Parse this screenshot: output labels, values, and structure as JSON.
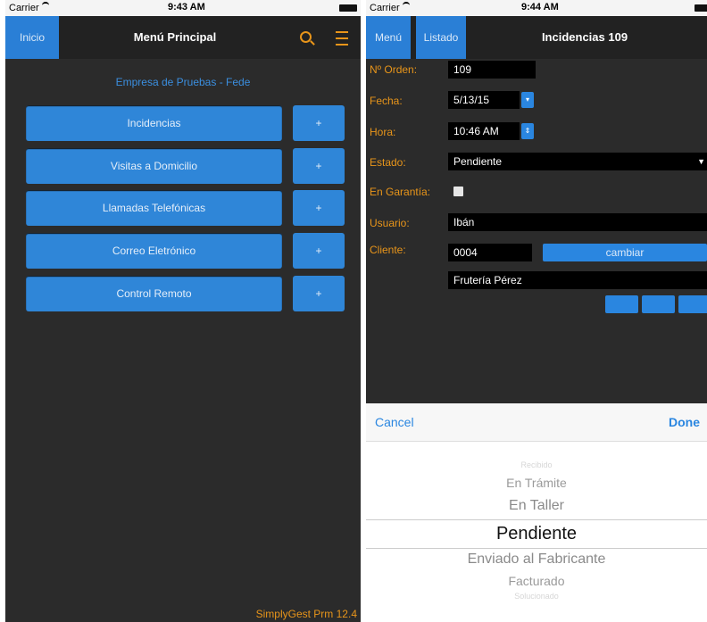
{
  "left_screen": {
    "status": {
      "carrier": "Carrier",
      "time": "9:43 AM"
    },
    "nav": {
      "home_label": "Inicio",
      "title": "Menú Principal",
      "search_icon": "search-icon",
      "menu_icon": "hamburger-icon"
    },
    "company": "Empresa de Pruebas - Fede",
    "menu_items": [
      {
        "label": "Incidencias",
        "plus": "+"
      },
      {
        "label": "Visitas a Domicilio",
        "plus": "+"
      },
      {
        "label": "Llamadas Telefónicas",
        "plus": "+"
      },
      {
        "label": "Correo Eletrónico",
        "plus": "+"
      },
      {
        "label": "Control Remoto",
        "plus": "+"
      }
    ],
    "footer": "SimplyGest Prm 12.4"
  },
  "right_screen": {
    "status": {
      "carrier": "Carrier",
      "time": "9:44 AM"
    },
    "nav": {
      "menu_label": "Menú",
      "list_label": "Listado",
      "title": "Incidencias 109"
    },
    "form": {
      "order_label": "Nº Orden:",
      "order_value": "109",
      "date_label": "Fecha:",
      "date_value": "5/13/15",
      "time_label": "Hora:",
      "time_value": "10:46 AM",
      "state_label": "Estado:",
      "state_value": "Pendiente",
      "warranty_label": "En Garantía:",
      "warranty_checked": false,
      "user_label": "Usuario:",
      "user_value": "Ibán",
      "client_label": "Cliente:",
      "client_code": "0004",
      "change_label": "cambiar",
      "client_name": "Frutería Pérez"
    },
    "picker": {
      "cancel_label": "Cancel",
      "done_label": "Done",
      "options": [
        "Recibido",
        "En Trámite",
        "En Taller",
        "Pendiente",
        "Enviado al Fabricante",
        "Facturado",
        "Solucionado"
      ],
      "selected": "Pendiente"
    }
  },
  "colors": {
    "accent_blue": "#2f86d8",
    "accent_orange": "#e8951a",
    "background": "#2b2b2b"
  }
}
